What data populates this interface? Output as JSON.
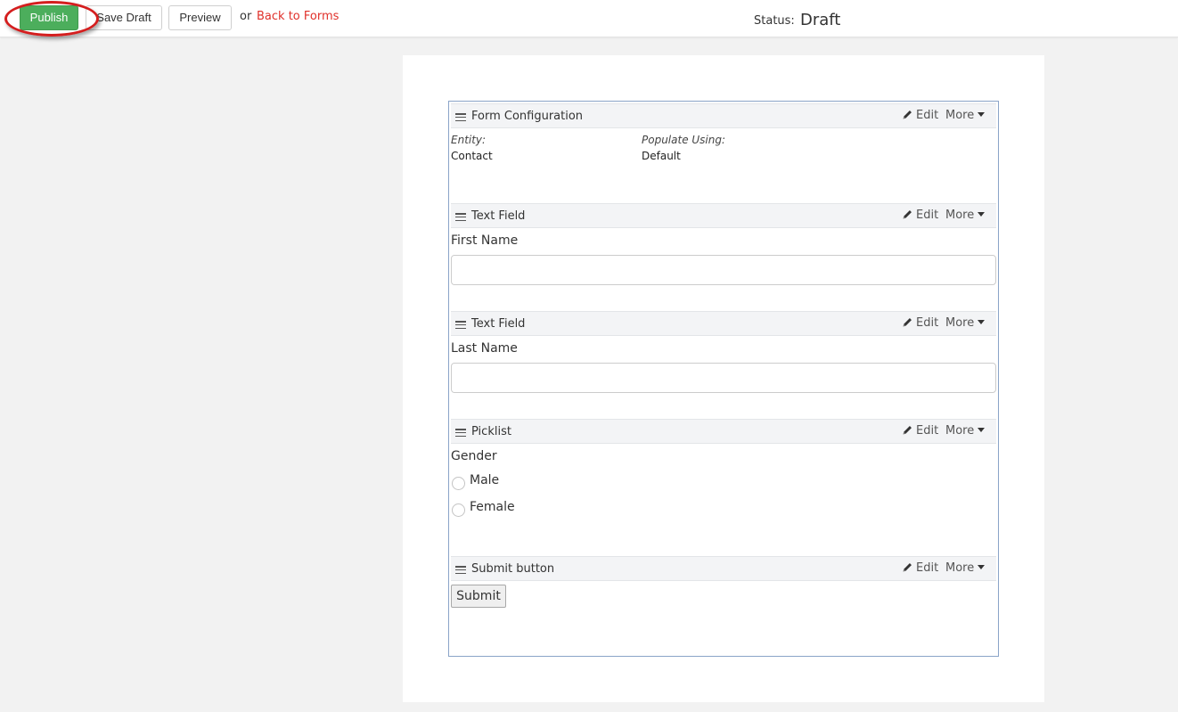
{
  "toolbar": {
    "publish_label": "Publish",
    "save_draft_label": "Save Draft",
    "preview_label": "Preview",
    "or_text": "or",
    "back_link_label": "Back to Forms",
    "status_label": "Status:",
    "status_value": "Draft"
  },
  "colors": {
    "publish_button": "#4cae5c",
    "back_link": "#e0302a",
    "highlight_ring": "#d41e1e",
    "frame_border": "#8aa4c8"
  },
  "form": {
    "sections": [
      {
        "type_label": "Form Configuration",
        "edit_label": "Edit",
        "more_label": "More",
        "entity_label": "Entity:",
        "entity_value": "Contact",
        "populate_label": "Populate Using:",
        "populate_value": "Default"
      },
      {
        "type_label": "Text Field",
        "edit_label": "Edit",
        "more_label": "More",
        "field_label": "First Name",
        "value": ""
      },
      {
        "type_label": "Text Field",
        "edit_label": "Edit",
        "more_label": "More",
        "field_label": "Last Name",
        "value": ""
      },
      {
        "type_label": "Picklist",
        "edit_label": "Edit",
        "more_label": "More",
        "field_label": "Gender",
        "options": [
          "Male",
          "Female"
        ]
      },
      {
        "type_label": "Submit button",
        "edit_label": "Edit",
        "more_label": "More",
        "button_label": "Submit"
      }
    ]
  },
  "icons": {
    "drag": "drag-handle-icon",
    "edit": "pencil-icon",
    "more": "caret-down-icon"
  }
}
